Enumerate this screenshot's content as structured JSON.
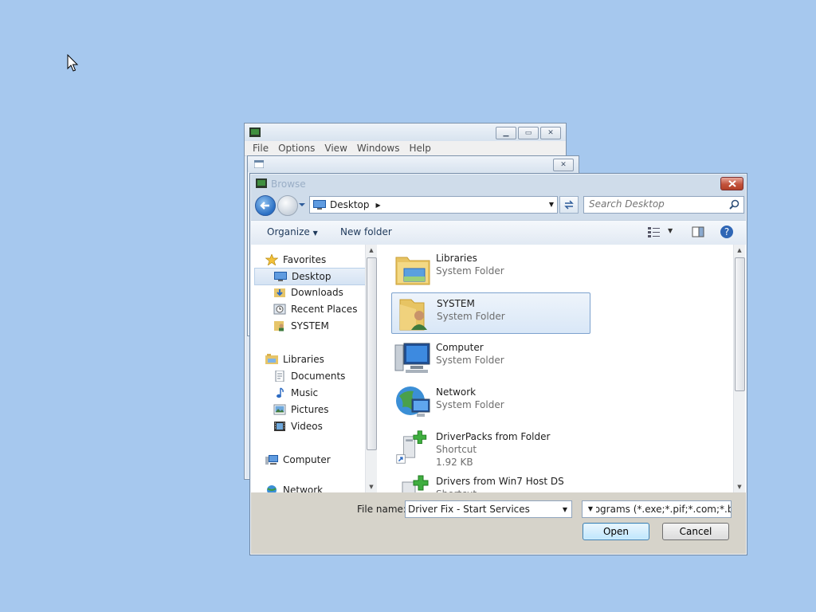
{
  "bg_window_1": {
    "menu": [
      "File",
      "Options",
      "View",
      "Windows",
      "Help"
    ]
  },
  "browse": {
    "title": "Browse",
    "address": {
      "crumb": "Desktop"
    },
    "search_placeholder": "Search Desktop",
    "toolbar": {
      "organize": "Organize",
      "new_folder": "New folder"
    },
    "nav": {
      "favorites": "Favorites",
      "desktop": "Desktop",
      "downloads": "Downloads",
      "recent": "Recent Places",
      "system": "SYSTEM",
      "libraries": "Libraries",
      "documents": "Documents",
      "music": "Music",
      "pictures": "Pictures",
      "videos": "Videos",
      "computer": "Computer",
      "network": "Network"
    },
    "files": [
      {
        "name": "Libraries",
        "type": "System Folder",
        "size": ""
      },
      {
        "name": "SYSTEM",
        "type": "System Folder",
        "size": ""
      },
      {
        "name": "Computer",
        "type": "System Folder",
        "size": ""
      },
      {
        "name": "Network",
        "type": "System Folder",
        "size": ""
      },
      {
        "name": "DriverPacks from Folder",
        "type": "Shortcut",
        "size": "1.92 KB"
      },
      {
        "name": "Drivers from Win7 Host DS",
        "type": "Shortcut",
        "size": ""
      }
    ],
    "footer": {
      "file_name_label": "File name:",
      "file_name_value": "Driver Fix - Start Services",
      "file_type": "Programs (*.exe;*.pif;*.com;*.bat;*.cmd)",
      "open": "Open",
      "cancel": "Cancel"
    }
  },
  "colors": {
    "desktop": "#a6c8ee",
    "selection_border": "#7da2ce",
    "close_red": "#c2533c"
  }
}
